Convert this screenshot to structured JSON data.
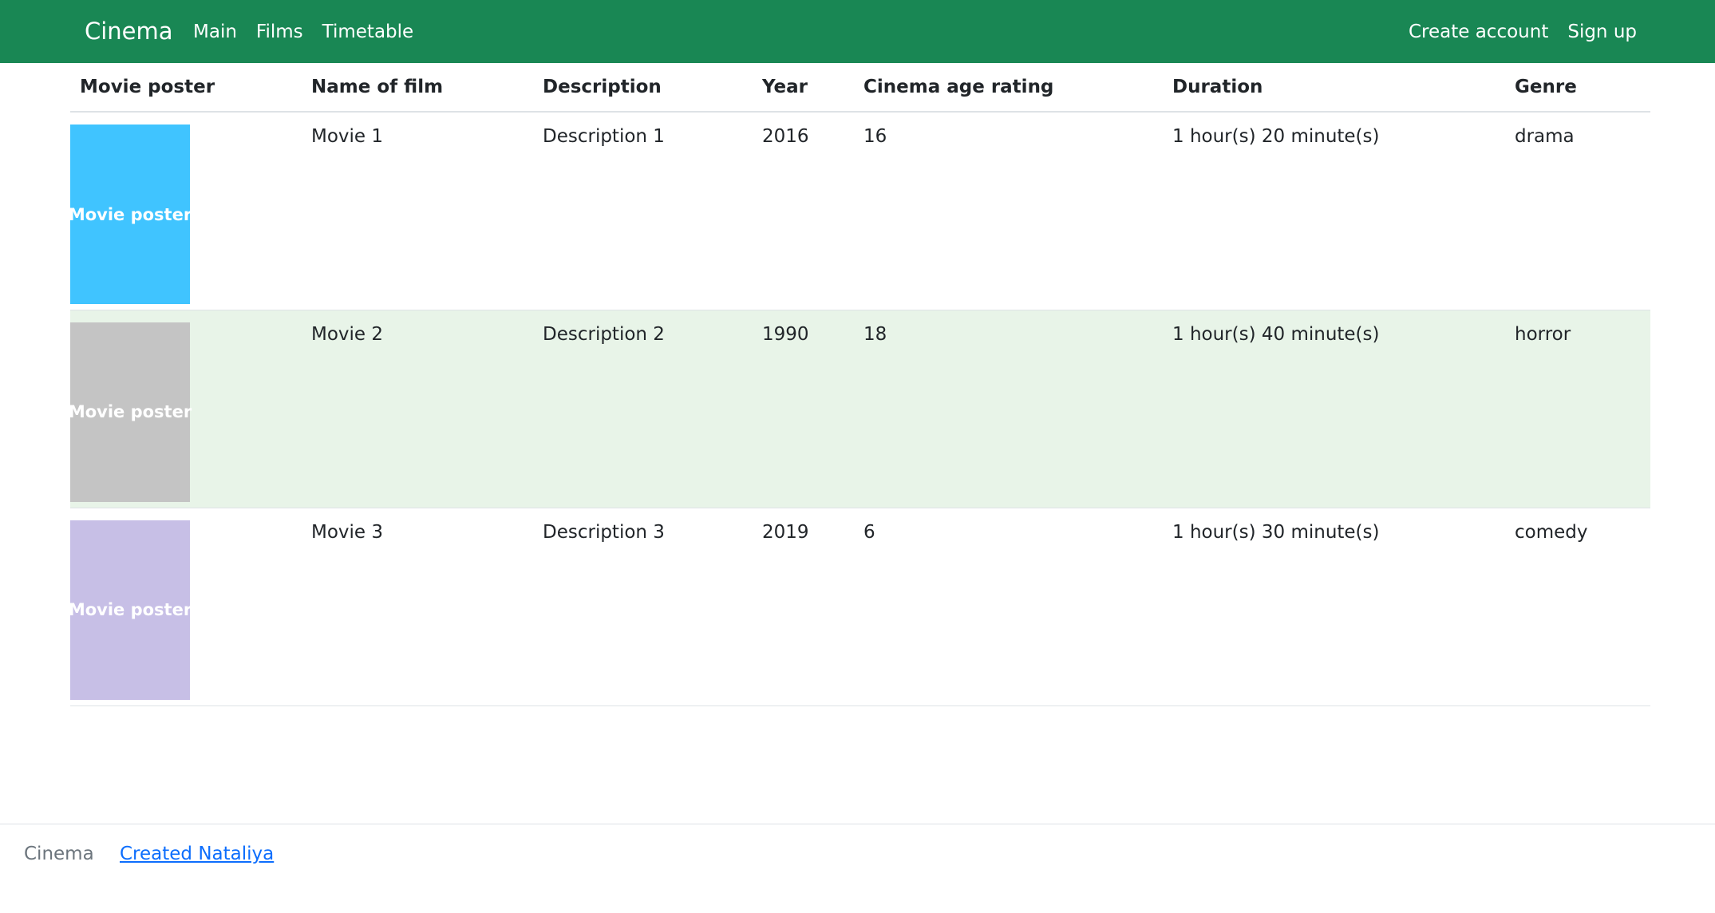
{
  "navbar": {
    "brand": "Cinema",
    "links": [
      "Main",
      "Films",
      "Timetable"
    ],
    "right_links": [
      "Create account",
      "Sign up"
    ],
    "background": "#198754"
  },
  "table": {
    "headers": [
      "Movie poster",
      "Name of film",
      "Description",
      "Year",
      "Cinema age rating",
      "Duration",
      "Genre"
    ],
    "rows": [
      {
        "poster_label": "Movie poster",
        "poster_color": "#40c4ff",
        "name": "Movie 1",
        "description": "Description 1",
        "year": "2016",
        "age_rating": "16",
        "duration": "1 hour(s) 20 minute(s)",
        "genre": "drama"
      },
      {
        "poster_label": "Movie poster",
        "poster_color": "#c4c4c4",
        "name": "Movie 2",
        "description": "Description 2",
        "year": "1990",
        "age_rating": "18",
        "duration": "1 hour(s) 40 minute(s)",
        "genre": "horror"
      },
      {
        "poster_label": "Movie poster",
        "poster_color": "#c7bfe6",
        "name": "Movie 3",
        "description": "Description 3",
        "year": "2019",
        "age_rating": "6",
        "duration": "1 hour(s) 30 minute(s)",
        "genre": "comedy"
      }
    ],
    "highlight_color": "#e8f4e8"
  },
  "footer": {
    "brand": "Cinema",
    "link": "Created Nataliya",
    "link_color": "#0d6efd"
  }
}
